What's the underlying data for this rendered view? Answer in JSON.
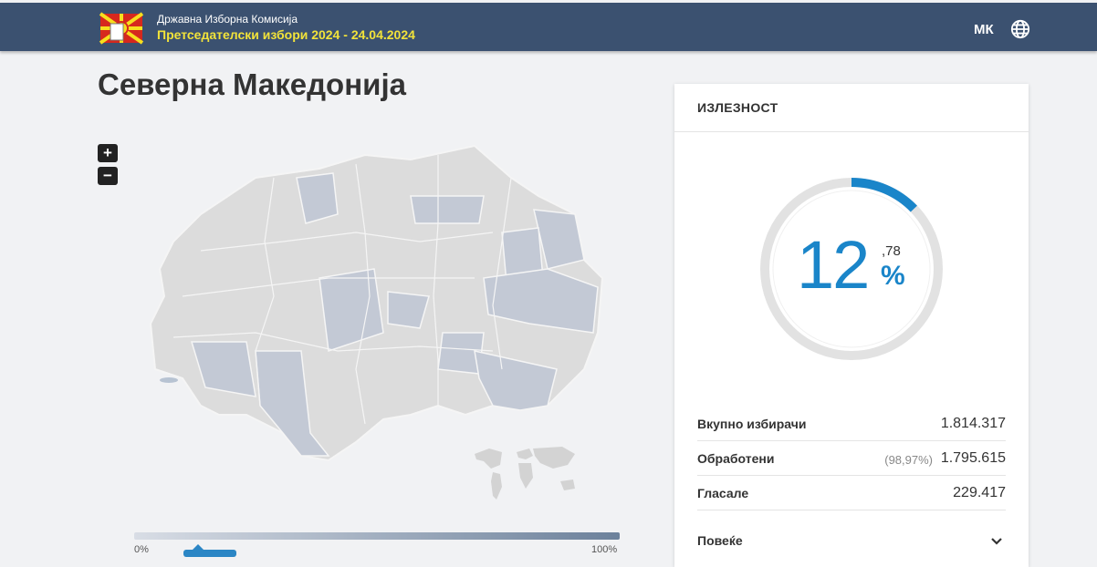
{
  "header": {
    "org_name": "Државна Изборна Комисија",
    "election_title": "Претседателски избори 2024 - 24.04.2024",
    "language": "МК",
    "logo_icon": "macedonia-flag-ballot-logo",
    "globe_icon": "globe-icon"
  },
  "page": {
    "title": "Северна Македонија"
  },
  "map": {
    "zoom_in_label": "+",
    "zoom_out_label": "−",
    "legend_min": "0%",
    "legend_max": "100%"
  },
  "turnout": {
    "title": "ИЗЛЕЗНОСТ",
    "percent_int": "12",
    "percent_dec": ",78",
    "percent_sign": "%",
    "percent_value": 12.78,
    "rows": [
      {
        "label": "Вкупно избирачи",
        "value": "1.814.317"
      },
      {
        "label": "Обработени",
        "pct": "(98,97%)",
        "value": "1.795.615"
      },
      {
        "label": "Гласале",
        "value": "229.417"
      }
    ],
    "more_label": "Повеќе"
  },
  "colors": {
    "header_bg": "#3b5170",
    "accent_blue": "#1a85c9",
    "title_yellow": "#f2e33a"
  }
}
